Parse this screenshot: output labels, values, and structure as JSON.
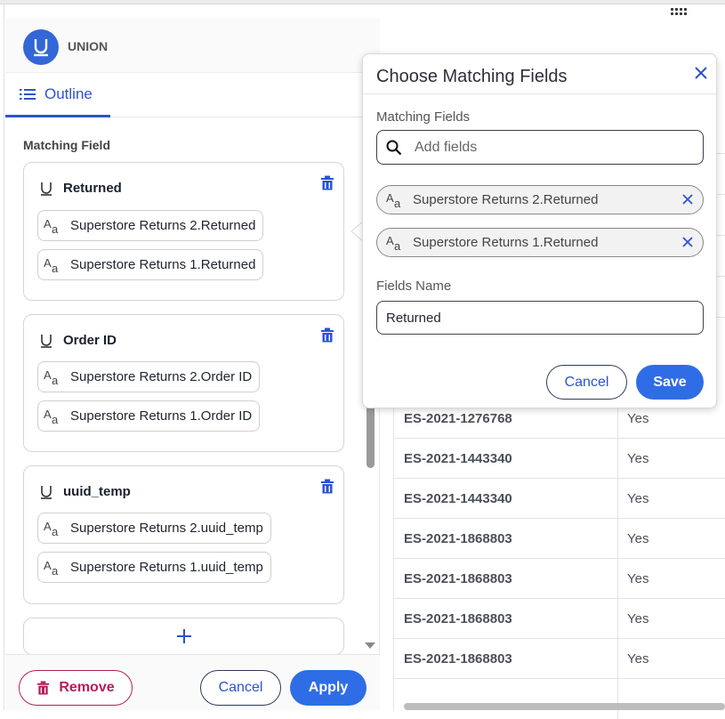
{
  "app": {
    "name": "UNION"
  },
  "tabs": [
    {
      "label": "Outline"
    }
  ],
  "outline": {
    "section_label": "Matching Field",
    "groups": [
      {
        "title": "Returned",
        "fields": [
          "Superstore Returns 2.Returned",
          "Superstore Returns 1.Returned"
        ]
      },
      {
        "title": "Order ID",
        "fields": [
          "Superstore Returns 2.Order ID",
          "Superstore Returns 1.Order ID"
        ]
      },
      {
        "title": "uuid_temp",
        "fields": [
          "Superstore Returns 2.uuid_temp",
          "Superstore Returns 1.uuid_temp"
        ]
      }
    ]
  },
  "footer": {
    "remove_label": "Remove",
    "cancel_label": "Cancel",
    "apply_label": "Apply"
  },
  "popup": {
    "title": "Choose Matching Fields",
    "matching_fields_label": "Matching Fields",
    "search_placeholder": "Add fields",
    "selected_fields": [
      "Superstore Returns 2.Returned",
      "Superstore Returns 1.Returned"
    ],
    "fields_name_label": "Fields Name",
    "fields_name_value": "Returned",
    "cancel_label": "Cancel",
    "save_label": "Save"
  },
  "table": {
    "rows": [
      {
        "id": "ES-2021-1276768",
        "value": "Yes"
      },
      {
        "id": "ES-2021-1443340",
        "value": "Yes"
      },
      {
        "id": "ES-2021-1443340",
        "value": "Yes"
      },
      {
        "id": "ES-2021-1868803",
        "value": "Yes"
      },
      {
        "id": "ES-2021-1868803",
        "value": "Yes"
      },
      {
        "id": "ES-2021-1868803",
        "value": "Yes"
      },
      {
        "id": "ES-2021-1868803",
        "value": "Yes"
      }
    ]
  },
  "colors": {
    "accent": "#2f6de6",
    "brand": "#3366d6",
    "danger": "#b81d5a"
  },
  "icons": {
    "logo": "union-icon",
    "tab": "list-icon",
    "group": "union-icon",
    "delete": "trash-icon",
    "field": "text-field-icon",
    "add": "plus-icon",
    "search": "search-icon",
    "close": "close-icon"
  }
}
